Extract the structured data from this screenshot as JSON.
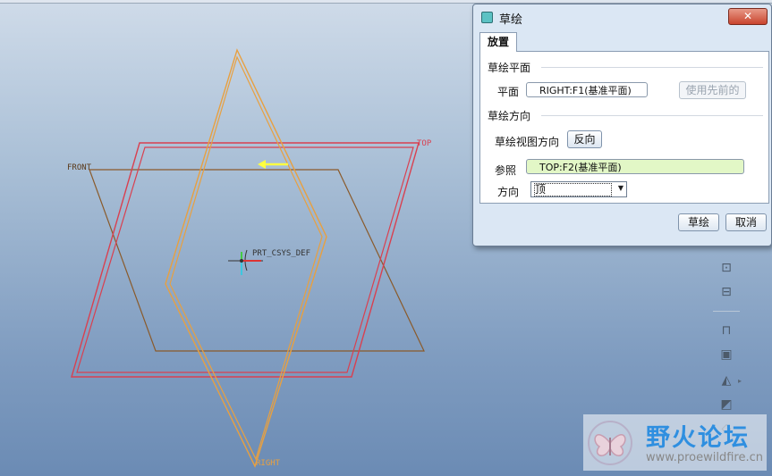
{
  "viewport": {
    "datum_planes": {
      "front_label": "FRONT",
      "top_label": "TOP",
      "right_label": "RIGHT"
    },
    "csys_label": "PRT_CSYS_DEF",
    "colors": {
      "top_plane": "#d94050",
      "front_plane": "#8a5a2a",
      "right_plane": "#e8a040",
      "arrow": "#ffff40"
    }
  },
  "dialog": {
    "title": "草绘",
    "close_icon": "close-x",
    "tab": "放置",
    "sketch_plane": {
      "section_label": "草绘平面",
      "plane_label": "平面",
      "plane_value": "RIGHT:F1(基准平面)",
      "use_previous_label": "使用先前的"
    },
    "sketch_orientation": {
      "section_label": "草绘方向",
      "view_direction_label": "草绘视图方向",
      "flip_label": "反向",
      "reference_label": "参照",
      "reference_value": "TOP:F2(基准平面)",
      "orientation_label": "方向",
      "orientation_value": "顶",
      "reference_color": "#e2f7c6"
    },
    "footer": {
      "sketch_button": "草绘",
      "cancel_button": "取消"
    }
  },
  "toolbar": {
    "icons": [
      "datum-point-icon",
      "datum-csys-icon",
      "mirror-icon",
      "extrude-icon",
      "draft-icon",
      "shell-icon",
      "rib-icon"
    ]
  },
  "watermark": {
    "title": "野火论坛",
    "url": "www.proewildfire.cn"
  }
}
